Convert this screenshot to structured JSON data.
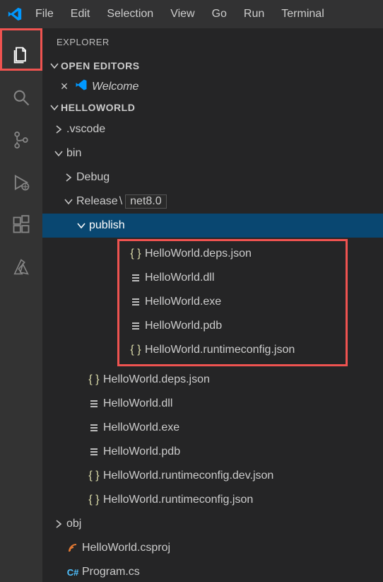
{
  "menu": {
    "file": "File",
    "edit": "Edit",
    "selection": "Selection",
    "view": "View",
    "go": "Go",
    "run": "Run",
    "terminal": "Terminal"
  },
  "sidebar": {
    "title": "EXPLORER",
    "open_editors": "OPEN EDITORS",
    "welcome": "Welcome",
    "workspace": "HELLOWORLD"
  },
  "tree": {
    "vscode": ".vscode",
    "bin": "bin",
    "debug": "Debug",
    "release": "Release",
    "pathsep": "\\",
    "framework": "net8.0",
    "publish": "publish",
    "files": {
      "deps": "HelloWorld.deps.json",
      "dll": "HelloWorld.dll",
      "exe": "HelloWorld.exe",
      "pdb": "HelloWorld.pdb",
      "runtime": "HelloWorld.runtimeconfig.json",
      "runtimedev": "HelloWorld.runtimeconfig.dev.json"
    },
    "obj": "obj",
    "csproj": "HelloWorld.csproj",
    "program": "Program.cs"
  }
}
